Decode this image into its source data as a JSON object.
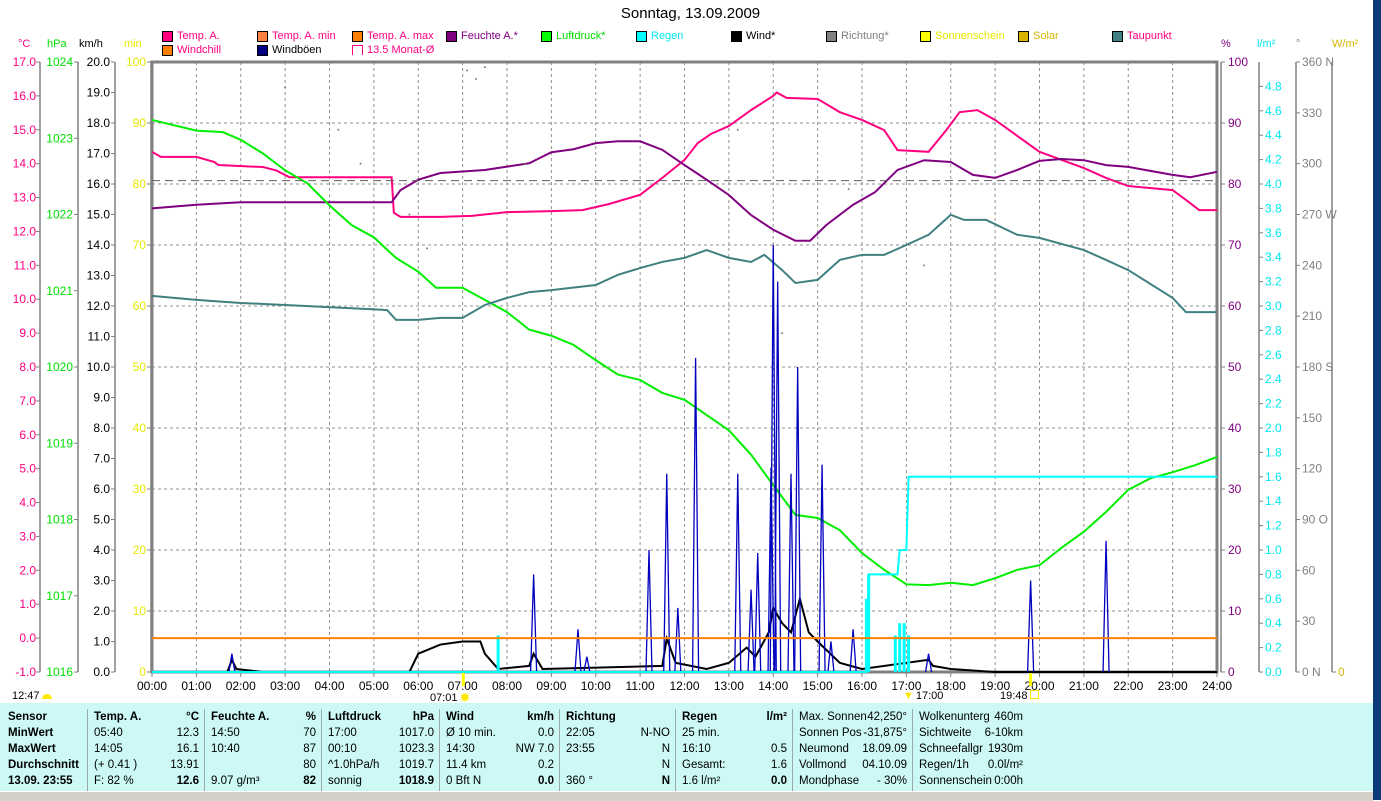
{
  "title": "Sonntag, 13.09.2009",
  "legend": [
    {
      "label": "Temp. A.",
      "box": "#ff0080",
      "text": "#ff0080"
    },
    {
      "label": "Temp. A. min",
      "box": "#ff8040",
      "text": "#ff0080"
    },
    {
      "label": "Temp. A. max",
      "box": "#ff8000",
      "text": "#ff0080"
    },
    {
      "label": "Feuchte A.*",
      "box": "#800080",
      "text": "#800080"
    },
    {
      "label": "Luftdruck*",
      "box": "#00ff00",
      "text": "#00e000"
    },
    {
      "label": "Regen",
      "box": "#00ffff",
      "text": "#00e8f0"
    },
    {
      "label": "Wind*",
      "box": "#000000",
      "text": "#000000"
    },
    {
      "label": "Richtung*",
      "box": "#808080",
      "text": "#808080"
    },
    {
      "label": "Sonnenschein",
      "box": "#ffff00",
      "text": "#e8e800"
    },
    {
      "label": "Solar",
      "box": "#d8b400",
      "text": "#d8b400"
    },
    {
      "label": "Taupunkt",
      "box": "#408080",
      "text": "#ff0080"
    },
    {
      "label": "Windchill",
      "box": "#ff8000",
      "text": "#ff0080"
    },
    {
      "label": "Windböen",
      "box": "#000080",
      "text": "#000000"
    },
    {
      "label": "13.5 Monat-Ø",
      "box": "bracket",
      "text": "#ff0080"
    }
  ],
  "units": {
    "celsius": "°C",
    "hpa": "hPa",
    "kmh": "km/h",
    "min": "min",
    "pct": "%",
    "rain": "l/m²",
    "deg": "°",
    "wm2": "W/m²"
  },
  "markers": [
    {
      "time": "12:47",
      "icon": "moon-icon"
    },
    {
      "time": "07:01",
      "icon": "sunrise-icon"
    },
    {
      "time": "17:00",
      "icon": "moon-marker-icon"
    },
    {
      "time": "19:48",
      "icon": "sunset-icon"
    }
  ],
  "chart_data": {
    "type": "line",
    "title": "Sonntag, 13.09.2009",
    "x_unit": "hours",
    "xlim": [
      0,
      24
    ],
    "x_ticks": [
      "00:00",
      "01:00",
      "02:00",
      "03:00",
      "04:00",
      "05:00",
      "06:00",
      "07:00",
      "08:00",
      "09:00",
      "10:00",
      "11:00",
      "12:00",
      "13:00",
      "14:00",
      "15:00",
      "16:00",
      "17:00",
      "18:00",
      "19:00",
      "20:00",
      "21:00",
      "22:00",
      "23:00",
      "24:00"
    ],
    "grid": true,
    "axes": {
      "celsius": {
        "color": "#ff0080",
        "range": [
          -1,
          17
        ],
        "ticks": [
          "17.0",
          "16.0",
          "15.0",
          "14.0",
          "13.0",
          "12.0",
          "11.0",
          "10.0",
          "9.0",
          "8.0",
          "7.0",
          "6.0",
          "5.0",
          "4.0",
          "3.0",
          "2.0",
          "1.0",
          "0.0",
          "-1.0"
        ]
      },
      "hpa": {
        "color": "#00e000",
        "range": [
          1016,
          1024
        ],
        "ticks": [
          "1024",
          "1023",
          "1022",
          "1021",
          "1020",
          "1019",
          "1018",
          "1017",
          "1016"
        ]
      },
      "kmh": {
        "color": "#000000",
        "range": [
          0,
          20
        ],
        "ticks": [
          "20.0",
          "19.0",
          "18.0",
          "17.0",
          "16.0",
          "15.0",
          "14.0",
          "13.0",
          "12.0",
          "11.0",
          "10.0",
          "9.0",
          "8.0",
          "7.0",
          "6.0",
          "5.0",
          "4.0",
          "3.0",
          "2.0",
          "1.0",
          "0.0"
        ]
      },
      "min": {
        "color": "#e8e800",
        "range": [
          0,
          100
        ],
        "ticks": [
          "100",
          "90",
          "80",
          "70",
          "60",
          "50",
          "40",
          "30",
          "20",
          "10",
          "0"
        ]
      },
      "pct": {
        "color": "#800080",
        "range": [
          0,
          100
        ],
        "ticks": [
          "100",
          "90",
          "80",
          "70",
          "60",
          "50",
          "40",
          "30",
          "20",
          "10",
          "0"
        ]
      },
      "rain": {
        "color": "#00e8f0",
        "range": [
          0,
          5
        ],
        "ticks": [
          "4.8",
          "4.6",
          "4.4",
          "4.2",
          "4.0",
          "3.8",
          "3.6",
          "3.4",
          "3.2",
          "3.0",
          "2.8",
          "2.6",
          "2.4",
          "2.2",
          "2.0",
          "1.8",
          "1.6",
          "1.4",
          "1.2",
          "1.0",
          "0.8",
          "0.6",
          "0.4",
          "0.2",
          "0.0"
        ]
      },
      "deg": {
        "color": "#808080",
        "range": [
          0,
          360
        ],
        "ticks": [
          "360 N",
          "330",
          "300",
          "270 W",
          "240",
          "210",
          "180 S",
          "150",
          "120",
          "90  O",
          "60",
          "30",
          "0   N"
        ]
      },
      "wm2": {
        "color": "#d8b400",
        "range": [
          0,
          0
        ],
        "ticks": [
          "0"
        ]
      }
    },
    "series": [
      {
        "name": "Temp. A.",
        "axis": "celsius",
        "color": "#ff0080",
        "x": [
          0,
          0.2,
          1,
          1.4,
          1.5,
          2.5,
          2.8,
          3.1,
          5.4,
          5.45,
          5.6,
          6.5,
          7.2,
          8,
          9,
          9.7,
          10.3,
          11,
          11.5,
          12,
          12.3,
          12.6,
          13,
          13.5,
          14,
          14.08,
          14.3,
          15,
          15.5,
          16,
          16.5,
          16.8,
          17.5,
          17.9,
          18.2,
          18.6,
          19,
          19.5,
          20,
          20.5,
          21,
          21.5,
          22,
          23,
          23.3,
          23.6,
          24
        ],
        "y": [
          14.35,
          14.2,
          14.2,
          14.05,
          13.96,
          13.9,
          13.8,
          13.6,
          13.6,
          12.55,
          12.43,
          12.43,
          12.46,
          12.57,
          12.6,
          12.63,
          12.81,
          13.08,
          13.58,
          14.11,
          14.61,
          14.88,
          15.11,
          15.58,
          16.0,
          16.1,
          15.94,
          15.91,
          15.52,
          15.29,
          14.99,
          14.4,
          14.35,
          14.99,
          15.52,
          15.58,
          15.29,
          14.82,
          14.35,
          14.11,
          13.87,
          13.58,
          13.34,
          13.22,
          12.93,
          12.63,
          12.63
        ]
      },
      {
        "name": "Feuchte A.*",
        "axis": "pct",
        "color": "#800080",
        "x": [
          0,
          1,
          2,
          5.4,
          5.6,
          6,
          6.5,
          7.5,
          8.5,
          9,
          9.5,
          10,
          10.5,
          11,
          11.5,
          12,
          12.5,
          13,
          13.5,
          14,
          14.5,
          14.83,
          15.2,
          15.8,
          16.3,
          16.8,
          17.4,
          18,
          18.5,
          19,
          19.5,
          20,
          20.5,
          21,
          21.5,
          22,
          23,
          23.4,
          24
        ],
        "y": [
          76,
          76.6,
          77,
          77,
          79,
          80.7,
          81.8,
          82.3,
          83.4,
          85.2,
          85.7,
          86.7,
          87,
          87,
          85.6,
          83.1,
          80.7,
          78.2,
          74.9,
          72.5,
          70.7,
          70.7,
          73.3,
          76.6,
          78.7,
          82.3,
          83.9,
          83.6,
          81.5,
          81,
          82.3,
          83.8,
          84.1,
          83.9,
          83.1,
          82.8,
          81.5,
          81.1,
          82
        ]
      },
      {
        "name": "Luftdruck*",
        "axis": "hpa",
        "color": "#00ee00",
        "x": [
          0,
          0.5,
          1,
          1.6,
          2,
          2.5,
          3,
          3.5,
          4,
          4.5,
          5,
          5.5,
          6,
          6.4,
          7,
          7.5,
          8,
          8.5,
          9,
          9.5,
          10,
          10.5,
          11,
          11.5,
          12,
          12.5,
          13,
          13.5,
          14,
          14.5,
          15,
          15.5,
          16,
          16.5,
          17,
          17.5,
          18,
          18.5,
          19,
          19.5,
          20,
          20.5,
          21,
          21.5,
          22,
          22.5,
          23,
          23.5,
          24
        ],
        "y": [
          1023.24,
          1023.17,
          1023.1,
          1023.08,
          1022.98,
          1022.8,
          1022.58,
          1022.41,
          1022.12,
          1021.86,
          1021.7,
          1021.43,
          1021.25,
          1021.04,
          1021.04,
          1020.88,
          1020.72,
          1020.49,
          1020.41,
          1020.29,
          1020.09,
          1019.9,
          1019.83,
          1019.66,
          1019.57,
          1019.37,
          1019.17,
          1018.85,
          1018.45,
          1018.06,
          1018.02,
          1017.86,
          1017.56,
          1017.34,
          1017.15,
          1017.14,
          1017.17,
          1017.14,
          1017.23,
          1017.34,
          1017.4,
          1017.63,
          1017.84,
          1018.1,
          1018.39,
          1018.54,
          1018.62,
          1018.71,
          1018.82
        ]
      },
      {
        "name": "Taupunkt",
        "axis": "celsius",
        "color": "#408080",
        "x": [
          0,
          1,
          2,
          3,
          5.3,
          5.5,
          6,
          6.5,
          7,
          7.5,
          8,
          8.5,
          9,
          10,
          10.5,
          11,
          11.5,
          12,
          12.5,
          13,
          13.5,
          13.8,
          14.2,
          14.5,
          15,
          15.5,
          16,
          16.5,
          17,
          17.5,
          18,
          18.3,
          18.8,
          19.5,
          20,
          21,
          21.5,
          22,
          23,
          23.3,
          24
        ],
        "y": [
          10.1,
          9.98,
          9.89,
          9.83,
          9.68,
          9.39,
          9.39,
          9.45,
          9.45,
          9.83,
          10.04,
          10.21,
          10.27,
          10.42,
          10.72,
          10.92,
          11.1,
          11.22,
          11.45,
          11.22,
          11.1,
          11.31,
          10.86,
          10.48,
          10.57,
          11.16,
          11.31,
          11.31,
          11.6,
          11.9,
          12.49,
          12.34,
          12.34,
          11.9,
          11.81,
          11.45,
          11.16,
          10.86,
          10.04,
          9.62,
          9.62
        ]
      },
      {
        "name": "Wind*",
        "axis": "kmh",
        "color": "#000000",
        "x": [
          0,
          1.7,
          1.8,
          1.9,
          2.5,
          5.8,
          6,
          6.5,
          7,
          7.4,
          7.5,
          7.8,
          8.5,
          8.6,
          8.8,
          11.5,
          11.6,
          11.8,
          12.5,
          13,
          13.4,
          13.6,
          13.9,
          14,
          14.2,
          14.4,
          14.6,
          14.8,
          15,
          15.5,
          16,
          17.5,
          17.6,
          18,
          19,
          24
        ],
        "y": [
          0,
          0,
          0.4,
          0.1,
          0,
          0,
          0.6,
          0.9,
          1.0,
          1.0,
          0.6,
          0.1,
          0.2,
          0.6,
          0.1,
          0.2,
          1.1,
          0.3,
          0.1,
          0.3,
          0.8,
          0.5,
          1.3,
          2.1,
          1.6,
          1.3,
          2.4,
          1.3,
          1.0,
          0.3,
          0.1,
          0.4,
          0.2,
          0.1,
          0,
          0
        ]
      },
      {
        "name": "Windböen",
        "axis": "kmh",
        "color": "#0000c0",
        "type": "spikes",
        "x": [
          1.8,
          8.6,
          9.6,
          9.8,
          11.2,
          11.6,
          11.85,
          12.25,
          13.2,
          13.5,
          13.65,
          13.95,
          14.0,
          14.1,
          14.4,
          14.55,
          15.1,
          15.3,
          15.8,
          17.5,
          19.8,
          21.5
        ],
        "y": [
          0.6,
          3.2,
          1.4,
          0.5,
          4.0,
          6.5,
          2.1,
          10.3,
          6.5,
          2.7,
          3.9,
          6.7,
          14.0,
          12.8,
          6.5,
          10.0,
          6.8,
          1.0,
          1.4,
          0.6,
          3.0,
          4.3
        ]
      },
      {
        "name": "Regen",
        "axis": "rain",
        "color": "#00ffff",
        "x": [
          0,
          16.1,
          16.15,
          16.8,
          16.85,
          17.0,
          17.05,
          24
        ],
        "y": [
          0,
          0,
          0.8,
          0.8,
          1.0,
          1.0,
          1.6,
          1.6
        ]
      },
      {
        "name": "Regen (Intervall)",
        "axis": "rain",
        "color": "#00ffff",
        "type": "bars",
        "x": [
          7.8,
          16.1,
          16.15,
          16.75,
          16.85,
          16.95,
          17.05
        ],
        "y": [
          0.3,
          0.6,
          0.8,
          0.3,
          0.4,
          0.4,
          0.3
        ]
      },
      {
        "name": "Windchill",
        "axis": "celsius",
        "color": "#ff8000",
        "x": [
          0,
          24
        ],
        "y": [
          0.0,
          0.0
        ]
      },
      {
        "name": "13.5 Monat-Ø",
        "axis": "celsius",
        "color": "#606060",
        "type": "dashed",
        "x": [
          0,
          24
        ],
        "y": [
          13.5,
          13.5
        ]
      },
      {
        "name": "Richtung*",
        "axis": "deg",
        "color": "#808080",
        "type": "points",
        "x": [
          3.0,
          4.2,
          4.7,
          5.8,
          6.2,
          7.1,
          7.3,
          7.5,
          8.4,
          9.0,
          13.2,
          14.2,
          15.7,
          17.4
        ],
        "y": [
          345,
          320,
          300,
          270,
          250,
          355,
          350,
          357,
          300,
          220,
          320,
          200,
          285,
          240
        ]
      }
    ]
  },
  "stats": {
    "sensor": {
      "header": "Sensor",
      "rows": [
        "MinWert",
        "MaxWert",
        "Durchschnitt",
        "13.09. 23:55"
      ]
    },
    "cols": [
      {
        "header": "Temp. A.",
        "unit": "°C",
        "rows": [
          [
            "05:40",
            "12.3"
          ],
          [
            "14:05",
            "16.1"
          ],
          [
            "(+ 0.41 )",
            "13.91"
          ],
          [
            "F: 82 %",
            "12.6"
          ]
        ]
      },
      {
        "header": "Feuchte A.",
        "unit": "%",
        "rows": [
          [
            "14:50",
            "70"
          ],
          [
            "10:40",
            "87"
          ],
          [
            "",
            "80"
          ],
          [
            "9.07 g/m³",
            "82"
          ]
        ]
      },
      {
        "header": "Luftdruck",
        "unit": "hPa",
        "rows": [
          [
            "17:00",
            "1017.0"
          ],
          [
            "00:10",
            "1023.3"
          ],
          [
            "^1.0hPa/h",
            "1019.7"
          ],
          [
            "sonnig",
            "1018.9"
          ]
        ]
      },
      {
        "header": "Wind",
        "unit": "km/h",
        "rows": [
          [
            "Ø 10 min.",
            "0.0"
          ],
          [
            "14:30",
            "NW 7.0"
          ],
          [
            "11.4 km",
            "0.2"
          ],
          [
            "0 Bft N",
            "0.0"
          ]
        ]
      },
      {
        "header": "Richtung",
        "unit": "",
        "rows": [
          [
            "22:05",
            "N-NO"
          ],
          [
            "23:55",
            "N"
          ],
          [
            "",
            "N"
          ],
          [
            "360 °",
            "N"
          ]
        ]
      },
      {
        "header": "Regen",
        "unit": "l/m²",
        "rows": [
          [
            "25 min.",
            ""
          ],
          [
            "16:10",
            "0.5"
          ],
          [
            "Gesamt:",
            "1.6"
          ],
          [
            "1.6 l/m²",
            "0.0"
          ]
        ]
      }
    ],
    "sun": [
      [
        "Max. Sonnen",
        "42,250°"
      ],
      [
        "Sonnen Pos",
        "-31,875°"
      ],
      [
        "Neumond",
        "18.09.09"
      ],
      [
        "Vollmond",
        "04.10.09"
      ],
      [
        "Mondphase",
        "- 30%"
      ]
    ],
    "misc": [
      [
        "Wolkenunterg",
        "460m"
      ],
      [
        "Sichtweite",
        "6-10km"
      ],
      [
        "Schneefallgr",
        "1930m"
      ],
      [
        "Regen/1h",
        "0.0l/m²"
      ],
      [
        "Sonnenschein",
        "0:00h"
      ]
    ]
  }
}
